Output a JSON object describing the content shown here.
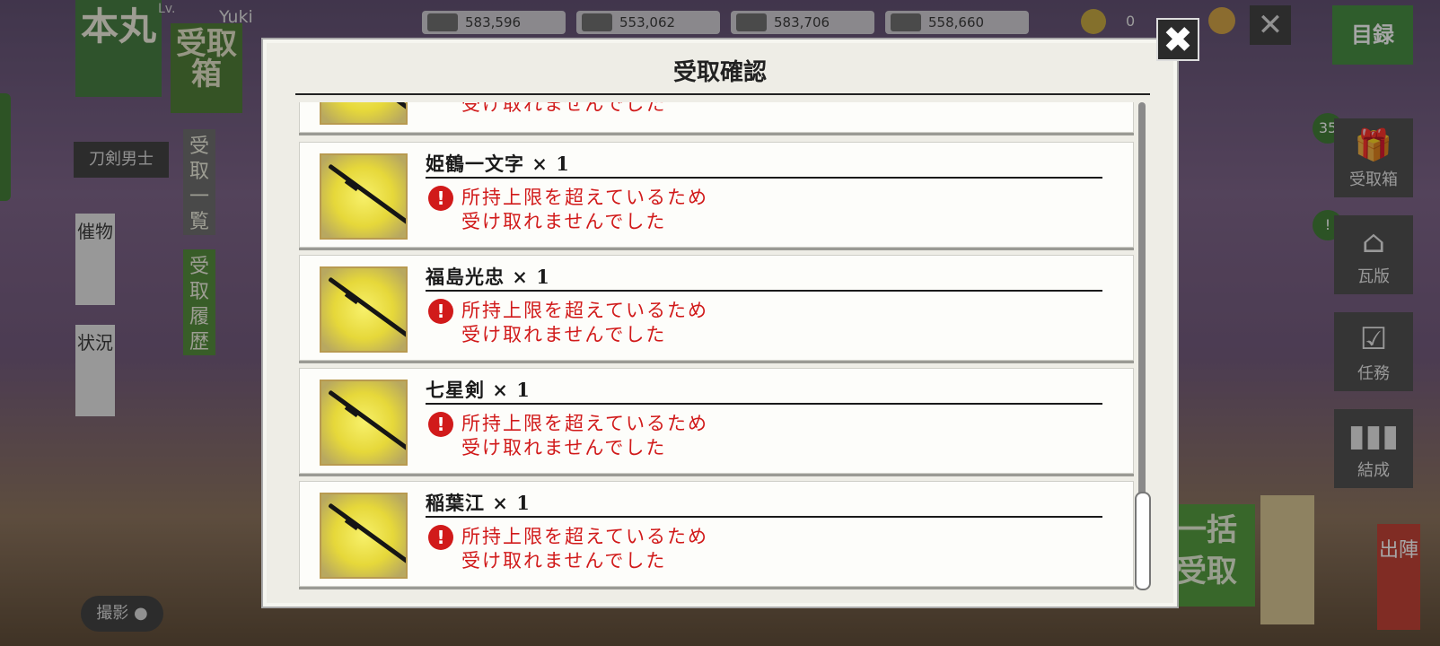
{
  "header": {
    "honmaru_label": "本丸",
    "level_label": "Lv.",
    "user_name": "Yuki",
    "resources": [
      "583,596",
      "553,062",
      "583,706",
      "558,660"
    ],
    "coin_value": "0",
    "mokuroku_label": "目録",
    "close_label": "✕"
  },
  "left": {
    "uketori_tab": "受取箱",
    "token_label": "刀剣男士",
    "moyooshi_label": "催物",
    "jokyo_label": "状況",
    "uketori_ichiran": "受取一覧",
    "uketori_rireki": "受取履歴",
    "satsuei_label": "撮影"
  },
  "right": {
    "gift_badge": "35",
    "gift_label": "受取箱",
    "shop_badge": "!",
    "shop_label": "瓦版",
    "task_label": "任務",
    "team_label": "結成",
    "shutsujin_label": "出陣",
    "ikkatsu_label": "一括受取"
  },
  "modal": {
    "title": "受取確認",
    "close_icon": "✖",
    "items": [
      {
        "name": "",
        "line1": "",
        "line2": "受け取れませんでした"
      },
      {
        "name": "姫鶴一文字 × 1",
        "line1": "所持上限を超えているため",
        "line2": "受け取れませんでした"
      },
      {
        "name": "福島光忠 × 1",
        "line1": "所持上限を超えているため",
        "line2": "受け取れませんでした"
      },
      {
        "name": "七星剣 × 1",
        "line1": "所持上限を超えているため",
        "line2": "受け取れませんでした"
      },
      {
        "name": "稲葉江 × 1",
        "line1": "所持上限を超えているため",
        "line2": "受け取れませんでした"
      }
    ]
  },
  "colors": {
    "warning_red": "#d11a1a",
    "accent_green": "#3f7a3a"
  }
}
